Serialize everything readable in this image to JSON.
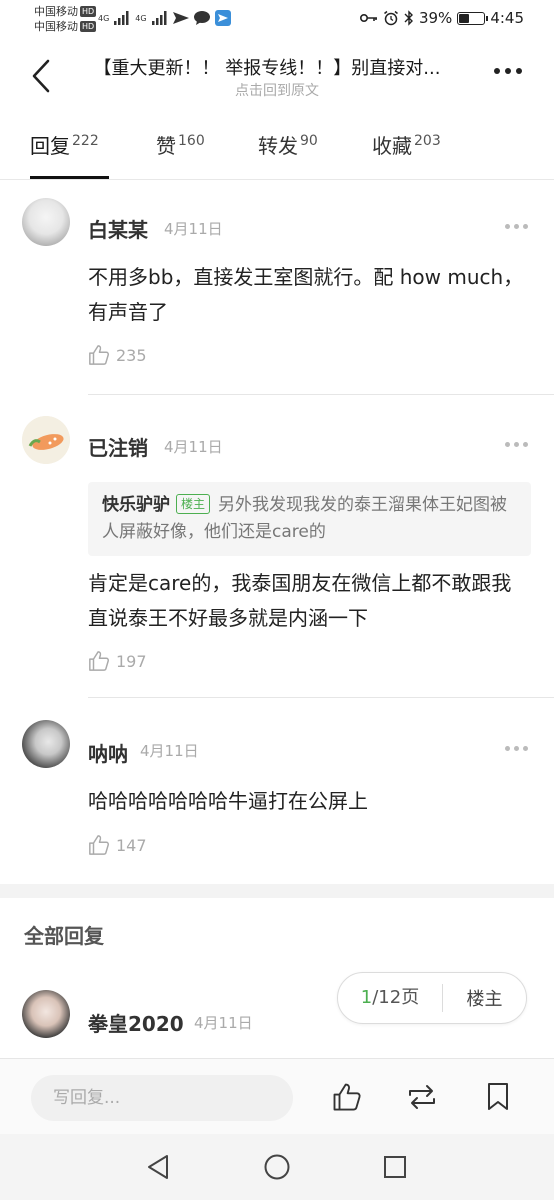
{
  "status_bar": {
    "carrier1": "中国移动",
    "carrier2": "中国移动",
    "hd": "HD",
    "net1": "4G",
    "net2": "4G",
    "battery": "39%",
    "battery_fraction": 0.39,
    "time": "4:45"
  },
  "header": {
    "title": "【重大更新！！ 举报专线！！】别直接对...",
    "subtitle": "点击回到原文"
  },
  "tabs": [
    {
      "label": "回复",
      "count": "222"
    },
    {
      "label": "赞",
      "count": "160"
    },
    {
      "label": "转发",
      "count": "90"
    },
    {
      "label": "收藏",
      "count": "203"
    }
  ],
  "hot_comments": [
    {
      "name": "白某某",
      "date": "4月11日",
      "text": "不用多bb，直接发王室图就行。配 how much，有声音了",
      "likes": "235"
    },
    {
      "name": "已注销",
      "date": "4月11日",
      "quote_name": "快乐驴驴",
      "quote_badge": "楼主",
      "quote_text": "另外我发现我发的泰王溜果体王妃图被人屏蔽好像，他们还是care的",
      "text": "肯定是care的，我泰国朋友在微信上都不敢跟我直说泰王不好最多就是内涵一下",
      "likes": "197"
    },
    {
      "name": "呐呐",
      "date": "4月11日",
      "text": "哈哈哈哈哈哈哈牛逼打在公屏上",
      "likes": "147"
    }
  ],
  "all_replies": {
    "title": "全部回复",
    "first": {
      "name": "拳皇2020",
      "date": "4月11日"
    }
  },
  "pager": {
    "current": "1",
    "total": "/12页",
    "op_label": "楼主"
  },
  "bottom_bar": {
    "reply_placeholder": "写回复..."
  },
  "icons": {
    "back": "back-arrow-icon",
    "more": "more-icon",
    "like": "thumbs-up-icon",
    "repost": "repost-icon",
    "bookmark": "bookmark-icon"
  }
}
